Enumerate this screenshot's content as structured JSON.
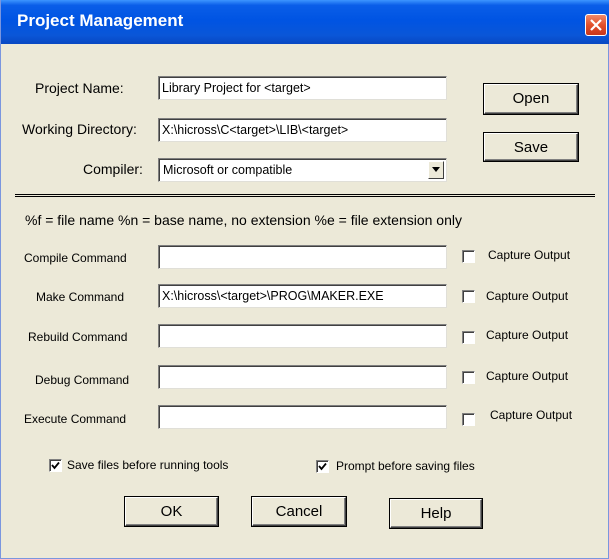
{
  "window": {
    "title": "Project Management"
  },
  "project": {
    "name_label": "Project Name:",
    "name_value": "Library Project for <target>",
    "dir_label": "Working Directory:",
    "dir_value": "X:\\hicross\\C<target>\\LIB\\<target>",
    "compiler_label": "Compiler:",
    "compiler_value": "Microsoft or compatible",
    "open_label": "Open",
    "save_label": "Save"
  },
  "help_text": "%f = file name %n = base name, no extension %e = file extension only",
  "commands": {
    "compile_label": "Compile Command",
    "compile_value": "",
    "make_label": "Make Command",
    "make_value": "X:\\hicross\\<target>\\PROG\\MAKER.EXE",
    "rebuild_label": "Rebuild Command",
    "rebuild_value": "",
    "debug_label": "Debug Command",
    "debug_value": "",
    "execute_label": "Execute Command",
    "execute_value": "",
    "capture_label": "Capture Output"
  },
  "options": {
    "save_files_label": "Save files before running tools",
    "save_files_checked": true,
    "prompt_label": "Prompt before saving files",
    "prompt_checked": true
  },
  "buttons": {
    "ok": "OK",
    "cancel": "Cancel",
    "help": "Help"
  },
  "colors": {
    "title_bar": "#0054e3",
    "dialog_bg": "#ece9d8",
    "close_button": "#e2502b"
  }
}
